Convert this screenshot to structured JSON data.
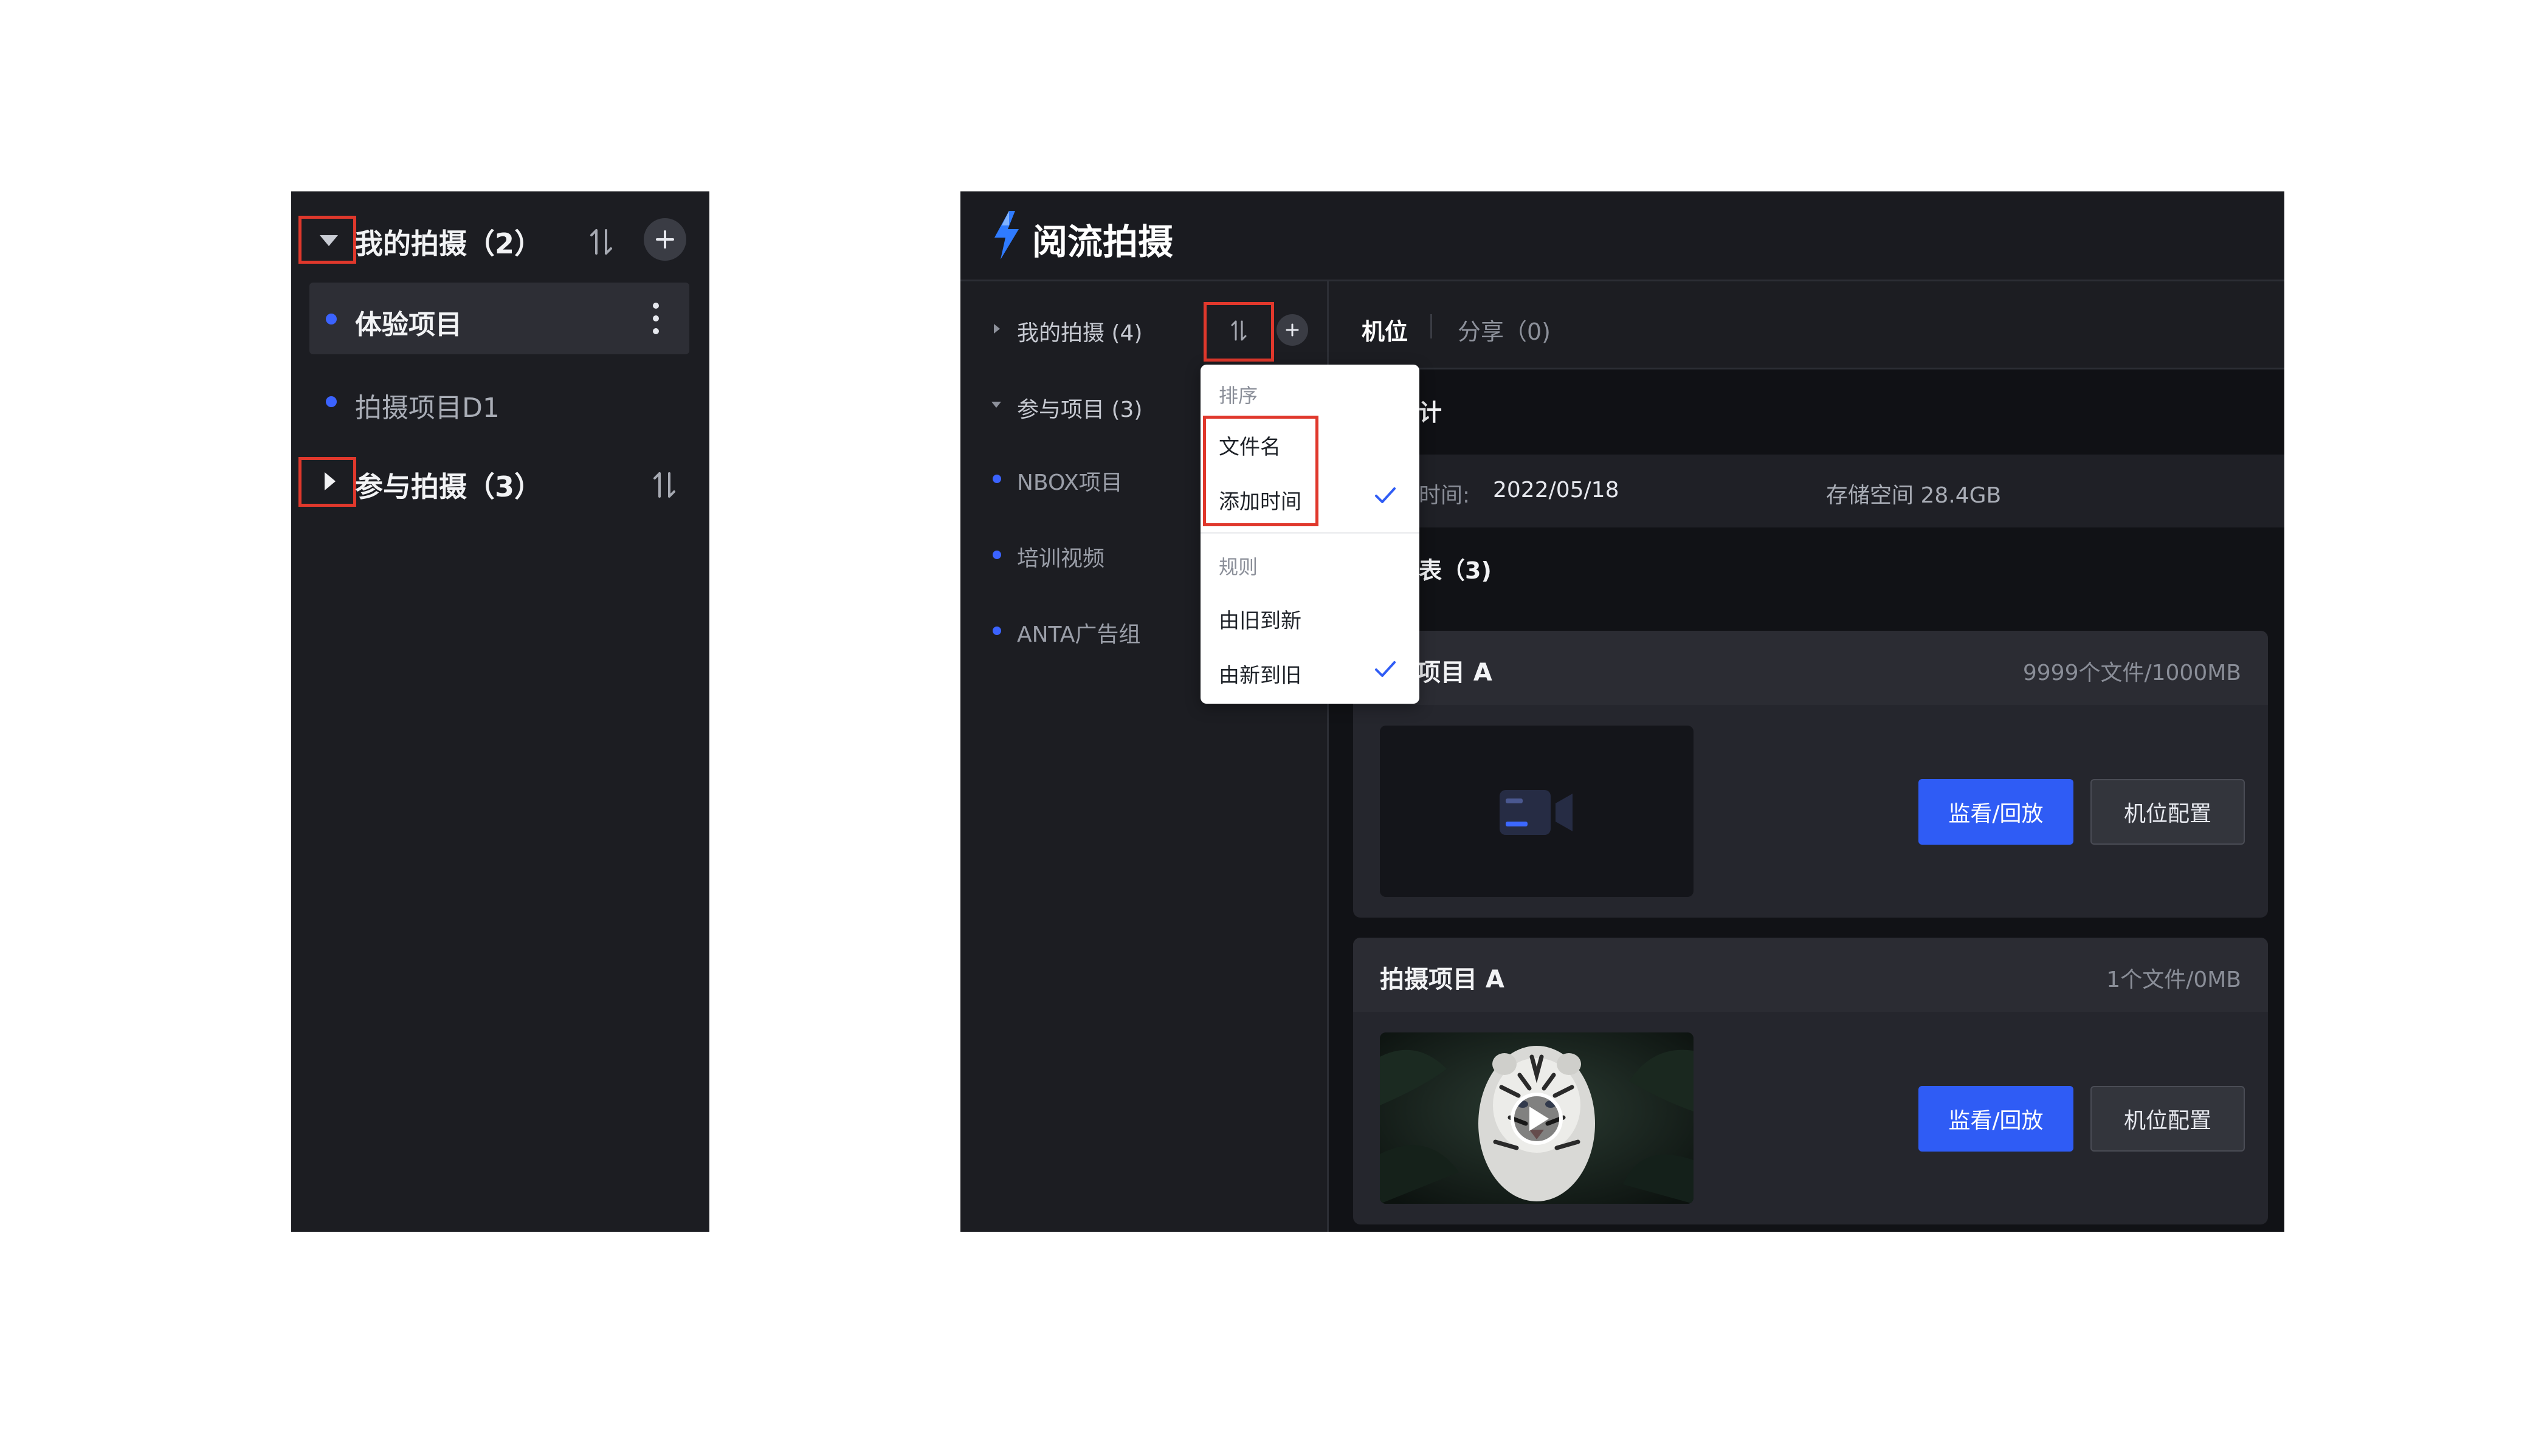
{
  "left_panel": {
    "group_mine": {
      "label": "我的拍摄（2）"
    },
    "items": [
      {
        "label": "体验项目",
        "selected": true
      },
      {
        "label": "拍摄项目D1",
        "selected": false
      }
    ],
    "group_joined": {
      "label": "参与拍摄（3）"
    },
    "icons": {
      "collapse": "caret-down-icon",
      "expand": "caret-right-icon",
      "sort": "sort-icon",
      "add": "plus-icon",
      "more": "more-vertical-icon"
    }
  },
  "app": {
    "title": "阅流拍摄",
    "sidebar": {
      "mine": "我的拍摄 (4)",
      "joined": "参与项目 (3)",
      "items": [
        "NBOX项目",
        "培训视频",
        "ANTA广告组"
      ]
    },
    "tabs": [
      {
        "label": "机位",
        "active": true
      },
      {
        "label": "分享（0)",
        "active": false
      }
    ],
    "stats": {
      "heading": "计",
      "time_label": "时间:",
      "time_value": "2022/05/18",
      "storage": "存储空间 28.4GB"
    },
    "list_heading": "表（3)",
    "cards": [
      {
        "title": "项目 A",
        "meta": "9999个文件/1000MB",
        "primary": "监看/回放",
        "secondary": "机位配置"
      },
      {
        "title": "拍摄项目 A",
        "meta": "1个文件/0MB",
        "primary": "监看/回放",
        "secondary": "机位配置"
      }
    ],
    "dropdown": {
      "sort_section": "排序",
      "sort_options": [
        {
          "label": "文件名",
          "checked": false
        },
        {
          "label": "添加时间",
          "checked": true
        }
      ],
      "rule_section": "规则",
      "rule_options": [
        {
          "label": "由旧到新",
          "checked": false
        },
        {
          "label": "由新到旧",
          "checked": true
        }
      ]
    }
  },
  "colors": {
    "panel_bg": "#1c1d22",
    "accent": "#2f5cf5",
    "dot": "#3b63ff",
    "highlight_border": "#e0382c"
  }
}
